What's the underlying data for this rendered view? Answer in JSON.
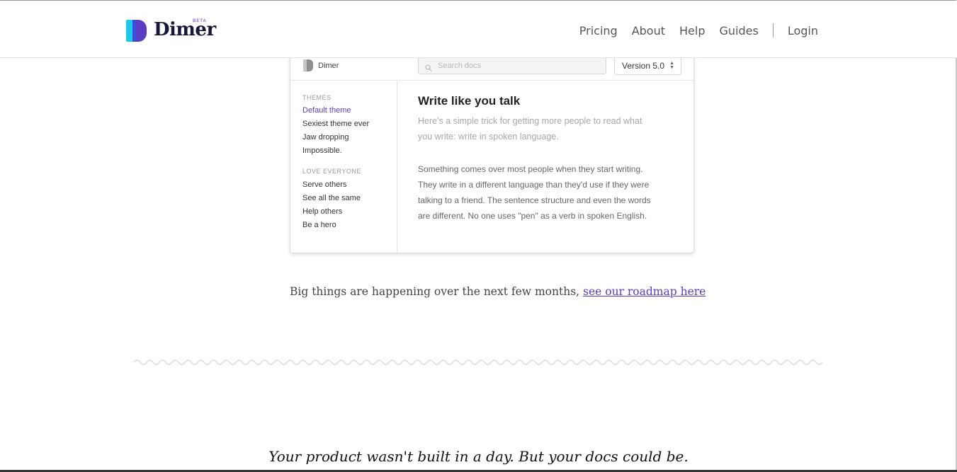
{
  "header": {
    "brand": "Dimer",
    "beta": "BETA",
    "nav": [
      "Pricing",
      "About",
      "Help",
      "Guides"
    ],
    "login": "Login"
  },
  "demo": {
    "brand": "Dimer",
    "search_placeholder": "Search docs",
    "version": "Version 5.0",
    "sidebar": {
      "groups": [
        {
          "heading": "THEMES",
          "items": [
            "Default theme",
            "Sexiest theme ever",
            "Jaw dropping",
            "Impossible."
          ]
        },
        {
          "heading": "LOVE EVERYONE",
          "items": [
            "Serve others",
            "See all the same",
            "Help others",
            "Be a hero"
          ]
        }
      ],
      "active_item": "Default theme"
    },
    "article": {
      "title": "Write like you talk",
      "lead": "Here's a simple trick for getting more people to read what you write: write in spoken language.",
      "body": "Something comes over most people when they start writing. They write in a different language than they'd use if they were talking to a friend. The sentence structure and even the words are different. No one uses \"pen\" as a verb in spoken English."
    }
  },
  "roadmap": {
    "text": "Big things are happening over the next few months, ",
    "link": "see our roadmap here"
  },
  "tagline": "Your product wasn't built in a day. But your docs could be.",
  "colors": {
    "accent": "#5b3cc4",
    "brand_cyan": "#1ec8e8",
    "brand_purple": "#5b3cc4"
  }
}
